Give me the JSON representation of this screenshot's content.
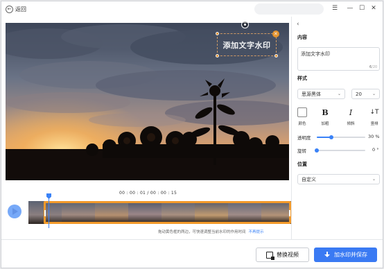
{
  "titlebar": {
    "back_label": "返回",
    "menu_icon": "hamburger-icon",
    "minimize_icon": "minimize-icon",
    "maximize_icon": "maximize-icon",
    "close_icon": "close-icon"
  },
  "preview": {
    "watermark_text": "添加文字水印"
  },
  "timeline": {
    "current_time": "00 : 00 : 01 / 00 : 00 : 15",
    "hint": "拖动黄色框的两边，可快速调整当前水印的作用时间",
    "hint_link": "不再提示"
  },
  "actions": {
    "replace_video": "替换视频",
    "add_and_save": "加水印并保存"
  },
  "panel": {
    "content_title": "内容",
    "content_value": "添加文字水印",
    "char_count": "6",
    "char_max": "/20",
    "style_title": "样式",
    "font_value": "思源黑体",
    "size_value": "20",
    "color_label": "颜色",
    "bold_glyph": "B",
    "bold_label": "加粗",
    "italic_glyph": "I",
    "italic_label": "倾斜",
    "vertical_glyph": "↓T",
    "vertical_label": "竖排",
    "opacity_label": "透明度",
    "opacity_value": "30 %",
    "opacity_fraction": 0.3,
    "rotate_label": "旋转",
    "rotate_value": "0 °",
    "rotate_fraction": 0.0,
    "position_title": "位置",
    "position_value": "自定义"
  },
  "colors": {
    "accent": "#3a7af3",
    "selection": "#f39a2a"
  }
}
